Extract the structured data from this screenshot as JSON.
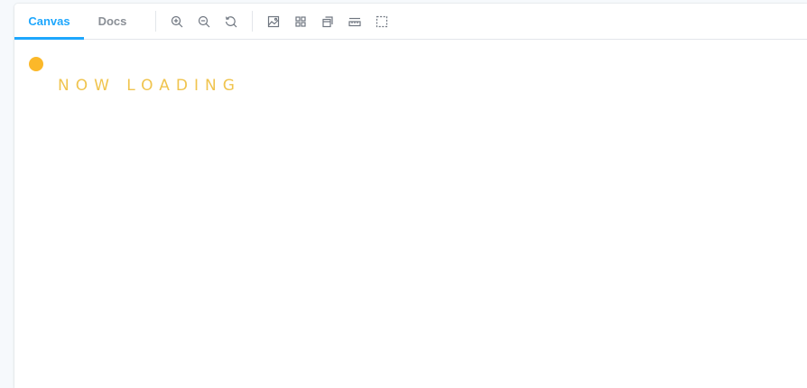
{
  "tabs": {
    "canvas": "Canvas",
    "docs": "Docs"
  },
  "toolbar_icons": [
    "zoom-in-icon",
    "zoom-out-icon",
    "reset-zoom-icon",
    "image-background-icon",
    "grid-icon",
    "outline-icon",
    "measure-icon",
    "select-area-icon"
  ],
  "status": {
    "loading_text": "NOW LOADING"
  },
  "colors": {
    "accent": "#1ea7fd",
    "loader": "#fbb829",
    "loading_text": "#f0c44e"
  }
}
